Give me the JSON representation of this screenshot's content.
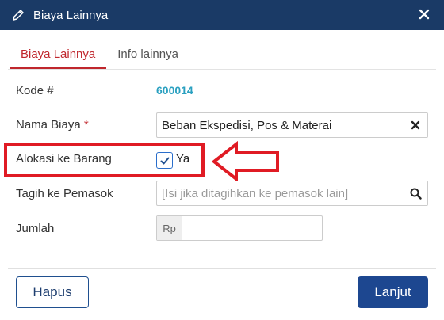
{
  "window": {
    "title": "Biaya Lainnya",
    "title_icon": "pencil-icon",
    "close_icon": "close-icon"
  },
  "tabs": [
    {
      "label": "Biaya Lainnya",
      "active": true
    },
    {
      "label": "Info lainnya",
      "active": false
    }
  ],
  "form": {
    "kode": {
      "label": "Kode #",
      "value": "600014"
    },
    "nama_biaya": {
      "label": "Nama Biaya",
      "required_mark": "*",
      "value": "Beban Ekspedisi, Pos & Materai",
      "clear_icon": "clear-icon"
    },
    "alokasi": {
      "label": "Alokasi ke Barang",
      "checkbox_label": "Ya",
      "checked": true
    },
    "tagih": {
      "label": "Tagih ke Pemasok",
      "placeholder": "[Isi jika ditagihkan ke pemasok lain]",
      "search_icon": "search-icon"
    },
    "jumlah": {
      "label": "Jumlah",
      "prefix": "Rp",
      "value": ""
    }
  },
  "footer": {
    "hapus_label": "Hapus",
    "lanjut_label": "Lanjut"
  },
  "annotation": {
    "color": "#e01b24",
    "shapes": [
      "highlight-box",
      "left-arrow"
    ]
  },
  "colors": {
    "titlebar": "#1a3a66",
    "accent_red": "#c0272d",
    "primary_button": "#1d4790",
    "kode_value": "#2aa0c0"
  }
}
